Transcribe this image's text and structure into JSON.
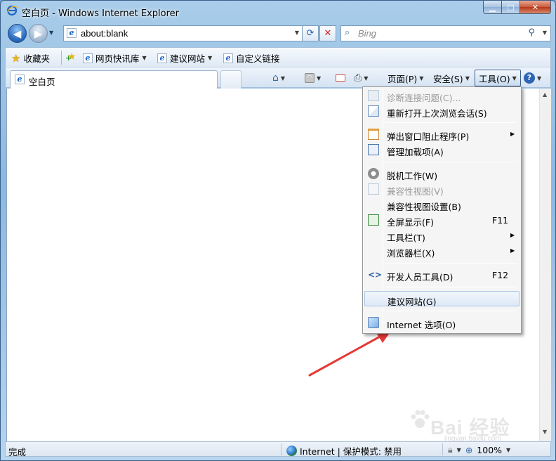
{
  "window": {
    "title": "空白页 - Windows Internet Explorer",
    "min_glyph": "▁",
    "max_glyph": "□",
    "close_glyph": "✕"
  },
  "nav": {
    "address": "about:blank",
    "search_placeholder": "Bing"
  },
  "favorites_bar": {
    "favorites_label": "收藏夹",
    "items": [
      {
        "label": "网页快讯库"
      },
      {
        "label": "建议网站"
      },
      {
        "label": "自定义链接"
      }
    ]
  },
  "tab": {
    "label": "空白页"
  },
  "command_bar": {
    "page_label": "页面(P)",
    "safety_label": "安全(S)",
    "tools_label": "工具(O)",
    "help_glyph": "?"
  },
  "tools_menu": {
    "items": [
      {
        "label": "诊断连接问题(C)...",
        "icon": "diagnose-icon",
        "disabled": true
      },
      {
        "label": "重新打开上次浏览会话(S)",
        "icon": "reopen-session-icon"
      },
      {
        "label": "弹出窗口阻止程序(P)",
        "icon": "popup-blocker-icon",
        "submenu": true
      },
      {
        "label": "管理加载项(A)",
        "icon": "addons-icon"
      },
      {
        "label": "脱机工作(W)",
        "icon": "offline-icon"
      },
      {
        "label": "兼容性视图(V)",
        "icon": "compat-view-icon",
        "disabled": true
      },
      {
        "label": "兼容性视图设置(B)"
      },
      {
        "label": "全屏显示(F)",
        "icon": "fullscreen-icon",
        "shortcut": "F11"
      },
      {
        "label": "工具栏(T)",
        "submenu": true
      },
      {
        "label": "浏览器栏(X)",
        "submenu": true
      },
      {
        "label": "开发人员工具(D)",
        "icon": "dev-tools-icon",
        "shortcut": "F12"
      },
      {
        "label": "建议网站(G)",
        "highlighted": true
      },
      {
        "label": "Internet 选项(O)",
        "icon": "internet-options-icon"
      }
    ]
  },
  "status_bar": {
    "status_text": "完成",
    "zone_text": "Internet | 保护模式: 禁用",
    "zoom": "100%"
  },
  "watermark": {
    "text": "Bai 经验",
    "sub": "jingyan.baidu.com"
  },
  "colors": {
    "annotation_arrow": "#e53935",
    "menu_highlight": "#dde9f7"
  }
}
